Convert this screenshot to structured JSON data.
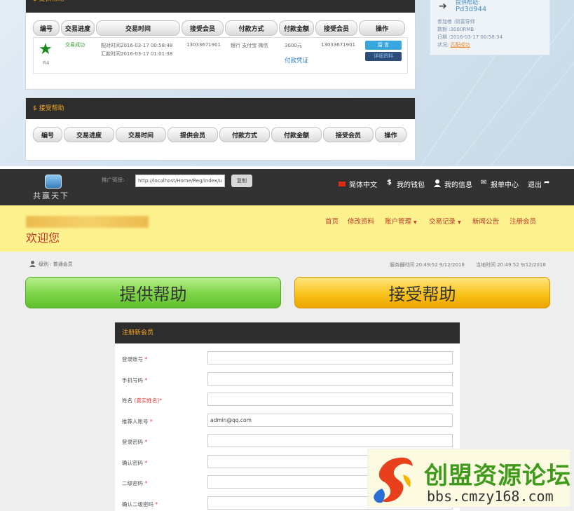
{
  "offer_section": {
    "title": "$ 提供帮助",
    "headers": [
      "编号",
      "交易进度",
      "交易时间",
      "接受会员",
      "付款方式",
      "付款金额",
      "接受会员",
      "操作"
    ],
    "row": {
      "code": "R4",
      "status": "交易成功",
      "match_time": "配对时间2016-03-17 00:58:48",
      "remit_time": "汇款时间2016-03-17 01:01:38",
      "member": "13033671901",
      "pay_method": "银行 支付宝 微信",
      "amount": "3000元",
      "voucher_link": "付款凭证",
      "receiver": "13033671901",
      "msg_btn": "留 言",
      "detail_btn": "详细资料"
    }
  },
  "receive_section": {
    "title": "$ 接受帮助",
    "headers": [
      "编号",
      "交易进度",
      "交易时间",
      "提供会员",
      "付款方式",
      "付款金额",
      "接受会员",
      "操作"
    ]
  },
  "side_card": {
    "title": "提供帮助:",
    "code": "Pd3d944",
    "participant": "参加者 :财富导师",
    "amount": "数额 :3000RMB",
    "date": "日期 :2016-03-17 00:58:34",
    "status_label": "状况:",
    "status_value": "匹配成功"
  },
  "navbar": {
    "logo_text": "共赢天下",
    "promo_label": "推广链接:",
    "promo_url": "http://localhost/Home/Reg/index/u",
    "copy_btn": "复制",
    "lang": "简体中文",
    "wallet": "我的钱包",
    "my_info": "我的信息",
    "report": "报单中心",
    "logout": "退出"
  },
  "header": {
    "welcome": "欢迎您",
    "menu": [
      "首页",
      "修改资料",
      "账户管理",
      "交易记录",
      "新闻公告",
      "注册会员"
    ]
  },
  "status_bar": {
    "level": "级别 : 普通会员",
    "server_time": "服务器时间  20:49:52 9/12/2018",
    "local_time": "当地时间  20:49:52 9/12/2018"
  },
  "actions": {
    "offer": "提供帮助",
    "receive": "接受帮助"
  },
  "register": {
    "title": "注册新会员",
    "fields": [
      {
        "label": "登录账号",
        "value": ""
      },
      {
        "label": "手机号码",
        "value": ""
      },
      {
        "label": "姓名",
        "hint": "(真实姓名)",
        "value": ""
      },
      {
        "label": "推荐人账号",
        "value": "admin@qq.com"
      },
      {
        "label": "登录密码",
        "value": ""
      },
      {
        "label": "确认密码",
        "value": ""
      },
      {
        "label": "二级密码",
        "value": ""
      },
      {
        "label": "确认二级密码",
        "value": ""
      }
    ]
  },
  "watermark": {
    "name": "创盟资源论坛",
    "url": "bbs.cmzy168.com"
  },
  "colors": {
    "dark_bar": "#2d2d2d",
    "accent_orange": "#f5a623",
    "header_yellow": "#fdf18e",
    "menu_red": "#c0392b",
    "green_btn": "#7ed94a",
    "orange_btn": "#f6b400"
  }
}
